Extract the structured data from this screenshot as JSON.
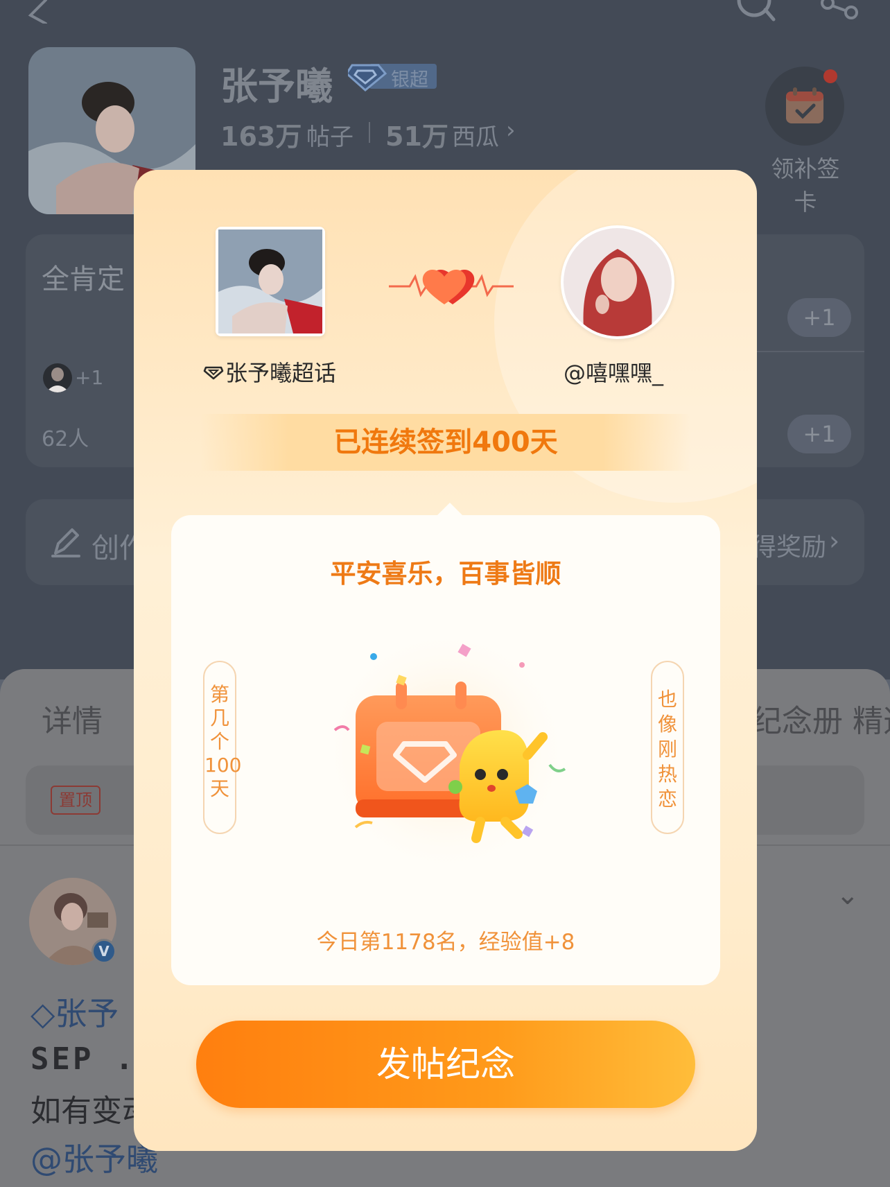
{
  "colors": {
    "accent_orange": "#f0780e",
    "button_gradient_start": "#ff7f0f",
    "button_gradient_end": "#ffbd3a",
    "modal_bg": "#fff0d6",
    "dim_overlay": "#434a56"
  },
  "icons": {
    "back": "back-arrow-icon",
    "search": "search-icon",
    "share": "share-icon",
    "calendar": "calendar-check-icon",
    "supertopic": "diamond-icon",
    "heartbeat": "heartbeat-hearts-icon",
    "create": "create-edit-icon"
  },
  "background": {
    "title": "张予曦",
    "level_badge": "银超",
    "stats": {
      "posts_value": "163万",
      "posts_label": "帖子",
      "melon_value": "51万",
      "melon_label": "西瓜",
      "melon_chevron": "›"
    },
    "checkin_card_label": "领补签卡",
    "fans_card": {
      "title": "全肯定",
      "plus_one": "+1",
      "mini_plus": "+1",
      "people_count": "62人"
    },
    "create_card": {
      "label": "创作",
      "reward_label": "得奖励",
      "chevron": "›"
    },
    "tabs": [
      "详情",
      "纪念册",
      "精选"
    ],
    "pinned_badge": "置顶",
    "post": {
      "tag_prefix": "张予",
      "line2": "SEP .",
      "line3": "如有变动",
      "mention": "@张予曦"
    }
  },
  "modal": {
    "supertopic_name": "张予曦超话",
    "user_handle": "@嘻嘿嘿_",
    "streak_text": "已连续签到400天",
    "blessing": "平安喜乐，百事皆顺",
    "left_scroll": "第几个100天",
    "right_scroll": "也像刚热恋",
    "rank_text": "今日第1178名，经验值+8",
    "post_button": "发帖纪念"
  }
}
